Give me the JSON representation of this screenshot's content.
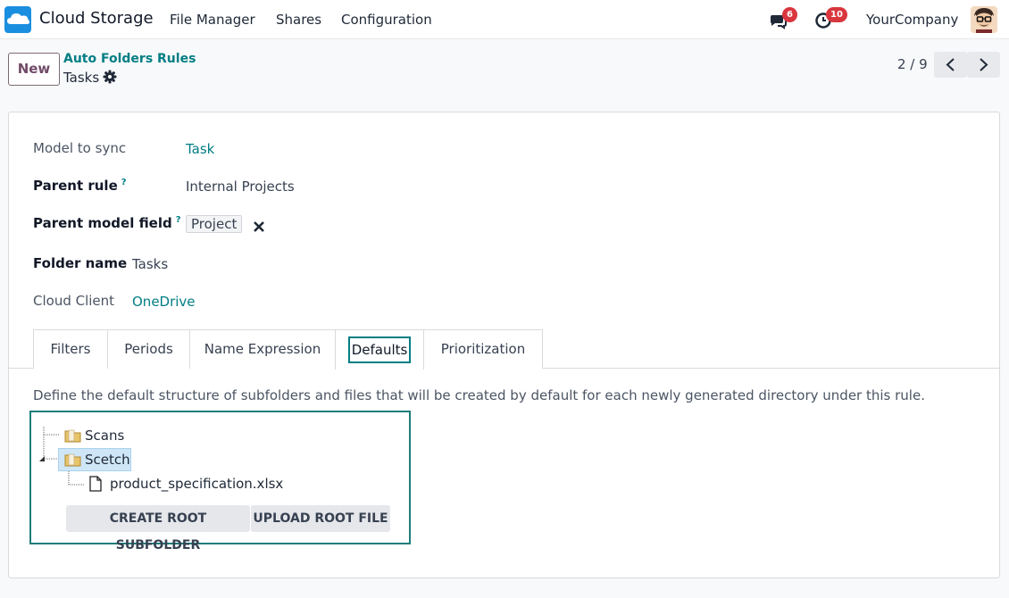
{
  "navbar": {
    "app_name": "Cloud Storage",
    "menu": [
      "File Manager",
      "Shares",
      "Configuration"
    ],
    "messages_count": "6",
    "activities_count": "10",
    "company": "YourCompany"
  },
  "control_panel": {
    "new_label": "New",
    "breadcrumb_parent": "Auto Folders Rules",
    "breadcrumb_current": "Tasks",
    "pager": "2 / 9"
  },
  "form": {
    "model_to_sync_label": "Model to sync",
    "model_to_sync_value": "Task",
    "parent_rule_label": "Parent rule",
    "parent_rule_value": "Internal Projects",
    "parent_model_field_label": "Parent model field",
    "parent_model_field_value": "Project",
    "folder_name_label": "Folder name",
    "folder_name_value": "Tasks",
    "cloud_client_label": "Cloud Client",
    "cloud_client_value": "OneDrive",
    "help_mark": "?"
  },
  "tabs": [
    "Filters",
    "Periods",
    "Name Expression",
    "Defaults",
    "Prioritization"
  ],
  "defaults": {
    "description": "Define the default structure of subfolders and files that will be created by default for each newly generated directory under this rule.",
    "tree": [
      "Scans",
      "Scetch",
      "product_specification.xlsx"
    ],
    "create_subfolder_label": "CREATE ROOT SUBFOLDER",
    "upload_file_label": "UPLOAD ROOT FILE"
  },
  "colors": {
    "accent": "#017e84",
    "brand": "#714b67",
    "badge": "#d9363e"
  }
}
